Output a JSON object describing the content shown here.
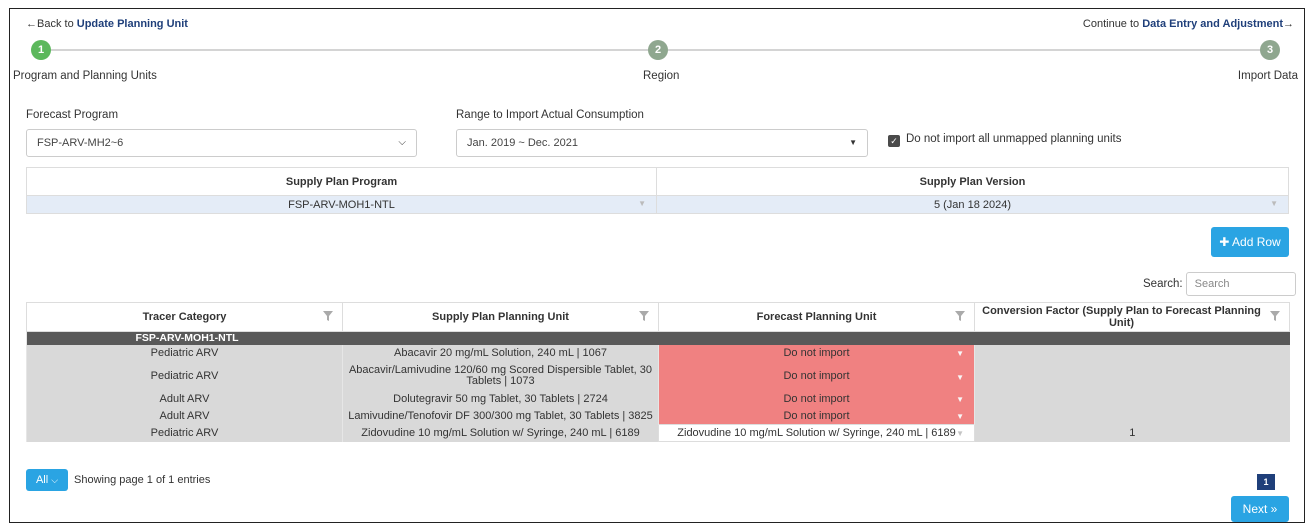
{
  "nav": {
    "back_prefix": "Back to",
    "back_link": "Update Planning Unit",
    "continue_prefix": "Continue to",
    "continue_link": "Data Entry and Adjustment"
  },
  "stepper": {
    "steps": [
      {
        "number": "1",
        "label": "Program and Planning Units",
        "color": "#5cb85c"
      },
      {
        "number": "2",
        "label": "Region",
        "color": "#8fa78f"
      },
      {
        "number": "3",
        "label": "Import Data",
        "color": "#8fa78f"
      }
    ]
  },
  "form": {
    "forecast_program_label": "Forecast Program",
    "forecast_program_value": "FSP-ARV-MH2~6",
    "range_label": "Range to Import Actual Consumption",
    "range_value": "Jan. 2019 ~ Dec. 2021",
    "checkbox_label": "Do not import all unmapped planning units",
    "checkbox_checked": true
  },
  "supply_plan": {
    "headers": [
      "Supply Plan Program",
      "Supply Plan Version"
    ],
    "row": [
      "FSP-ARV-MOH1-NTL",
      "5 (Jan 18 2024)"
    ]
  },
  "add_row_label": "Add Row",
  "search": {
    "label": "Search:",
    "placeholder": "Search"
  },
  "table": {
    "headers": [
      "Tracer Category",
      "Supply Plan Planning Unit",
      "Forecast Planning Unit",
      "Conversion Factor (Supply Plan to Forecast Planning Unit)"
    ],
    "group": "FSP-ARV-MOH1-NTL",
    "rows": [
      {
        "tracer": "Pediatric ARV",
        "unit": "Abacavir 20 mg/mL Solution, 240 mL | 1067",
        "forecast": "Do not import",
        "factor": ""
      },
      {
        "tracer": "Pediatric ARV",
        "unit": "Abacavir/Lamivudine 120/60 mg Scored Dispersible Tablet, 30 Tablets | 1073",
        "forecast": "Do not import",
        "factor": ""
      },
      {
        "tracer": "Adult ARV",
        "unit": "Dolutegravir 50 mg Tablet, 30 Tablets | 2724",
        "forecast": "Do not import",
        "factor": ""
      },
      {
        "tracer": "Adult ARV",
        "unit": "Lamivudine/Tenofovir DF 300/300 mg Tablet, 30 Tablets | 3825",
        "forecast": "Do not import",
        "factor": ""
      },
      {
        "tracer": "Pediatric ARV",
        "unit": "Zidovudine 10 mg/mL Solution w/ Syringe, 240 mL | 6189",
        "forecast": "Zidovudine 10 mg/mL Solution w/ Syringe, 240 mL | 6189",
        "factor": "1"
      }
    ]
  },
  "pagination": {
    "page_size": "All",
    "info": "Showing page 1 of 1 entries",
    "current_page": "1"
  },
  "next_label": "Next »",
  "colors": {
    "accent": "#2aa4e3",
    "do_not_import": "#f08181",
    "group_row": "#595959",
    "dark_blue": "#1f3f7a"
  }
}
